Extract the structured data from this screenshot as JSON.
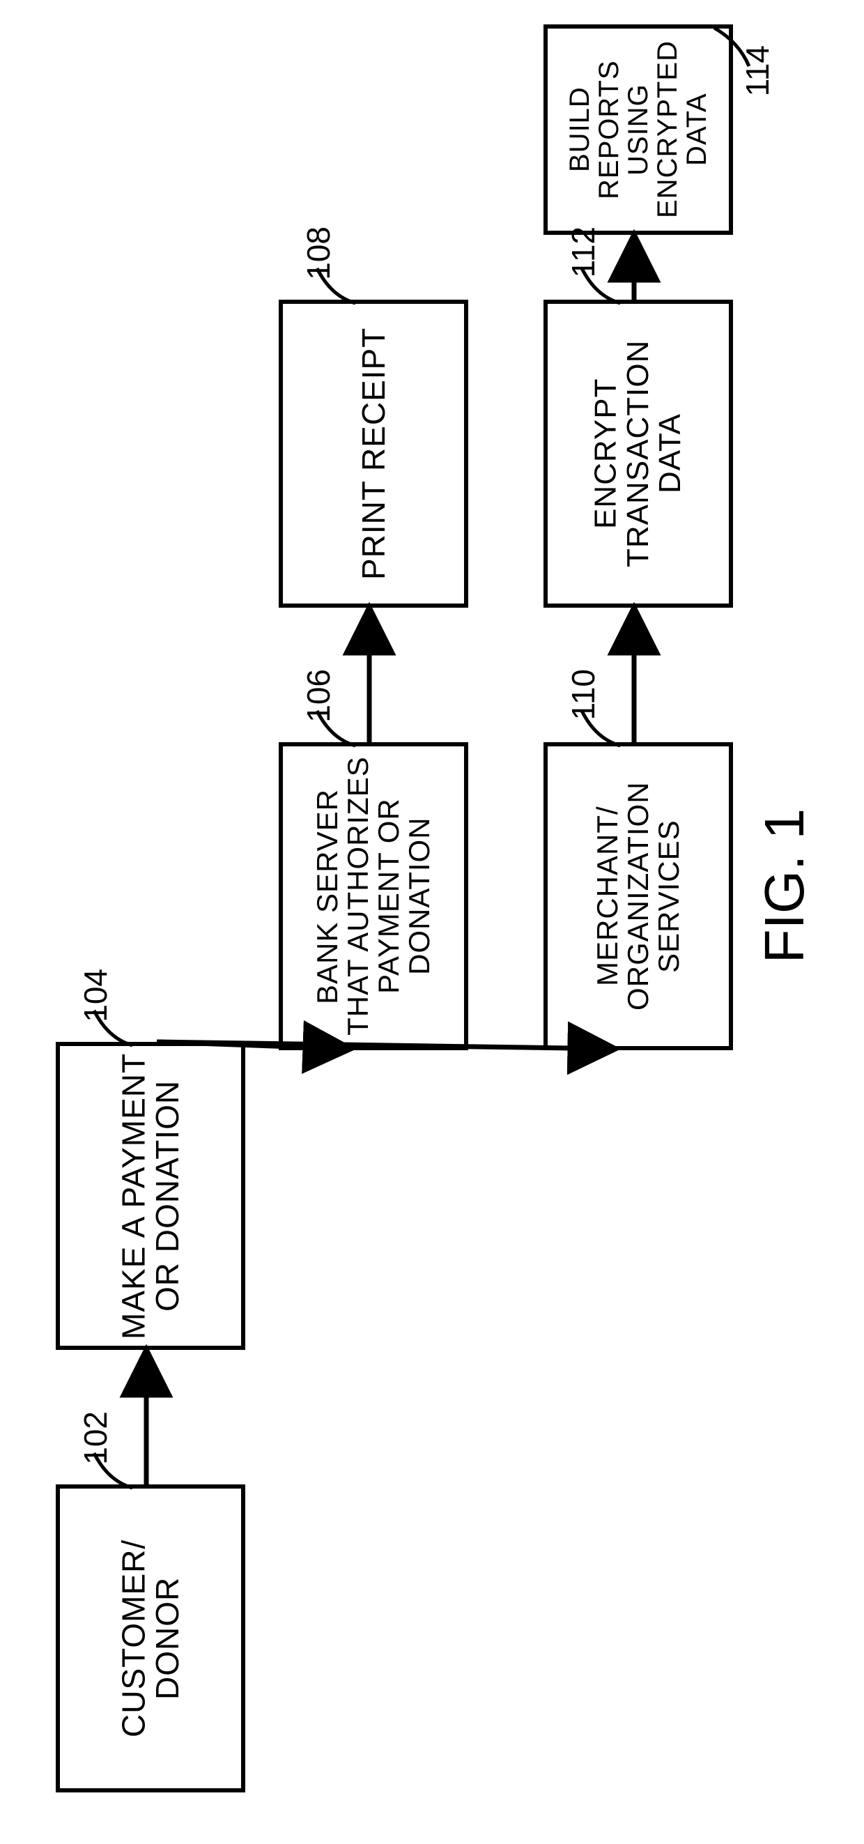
{
  "figure_label": "FIG. 1",
  "boxes": {
    "b102": {
      "text": "CUSTOMER/\nDONOR",
      "ref": "102"
    },
    "b104": {
      "text": "MAKE A PAYMENT\nOR DONATION",
      "ref": "104"
    },
    "b106": {
      "text": "BANK SERVER\nTHAT AUTHORIZES\nPAYMENT OR\nDONATION",
      "ref": "106"
    },
    "b108": {
      "text": "PRINT RECEIPT",
      "ref": "108"
    },
    "b110": {
      "text": "MERCHANT/\nORGANIZATION\nSERVICES",
      "ref": "110"
    },
    "b112": {
      "text": "ENCRYPT\nTRANSACTION\nDATA",
      "ref": "112"
    },
    "b114": {
      "text": "BUILD REPORTS\nUSING\nENCRYPTED\nDATA",
      "ref": "114"
    }
  },
  "chart_data": {
    "type": "flowchart",
    "nodes": [
      {
        "id": "102",
        "label": "CUSTOMER/ DONOR"
      },
      {
        "id": "104",
        "label": "MAKE A PAYMENT OR DONATION"
      },
      {
        "id": "106",
        "label": "BANK SERVER THAT AUTHORIZES PAYMENT OR DONATION"
      },
      {
        "id": "108",
        "label": "PRINT RECEIPT"
      },
      {
        "id": "110",
        "label": "MERCHANT/ ORGANIZATION SERVICES"
      },
      {
        "id": "112",
        "label": "ENCRYPT TRANSACTION DATA"
      },
      {
        "id": "114",
        "label": "BUILD REPORTS USING ENCRYPTED DATA"
      }
    ],
    "edges": [
      {
        "from": "102",
        "to": "104"
      },
      {
        "from": "104",
        "to": "106"
      },
      {
        "from": "104",
        "to": "110"
      },
      {
        "from": "106",
        "to": "108"
      },
      {
        "from": "110",
        "to": "112"
      },
      {
        "from": "112",
        "to": "114"
      }
    ],
    "figure_label": "FIG. 1"
  }
}
